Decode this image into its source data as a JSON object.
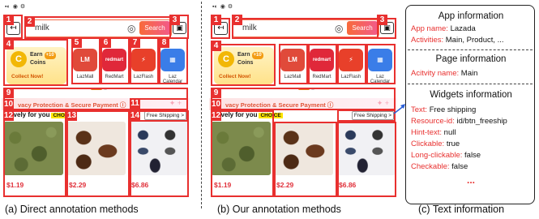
{
  "screen": {
    "search_text": "milk",
    "search_button": "Search",
    "coins_title": "Earn",
    "coins_badge": "+10",
    "coins_label": "Coins",
    "collect_now": "Collect Now!",
    "apps": [
      {
        "icon_text": "LM",
        "label": "LazMall",
        "color": "#e04a3a"
      },
      {
        "icon_text": "redmart",
        "label": "RedMart",
        "color": "#e0283a"
      },
      {
        "icon_text": "⚡",
        "label": "LazFlash",
        "color": "#e8402a"
      },
      {
        "icon_text": "▦",
        "label": "Laz Calendar",
        "color": "#3a7de8"
      }
    ],
    "privacy_text": "vacy Protection & Secure Payment ⓘ",
    "exclusive_text": "usively for you",
    "choice_badge": "CHOICE",
    "free_shipping": "Free Shipping >",
    "prices": [
      "$1.19",
      "$2.29",
      "$6.86"
    ]
  },
  "box_numbers": [
    "1",
    "2",
    "3",
    "4",
    "5",
    "6",
    "7",
    "8",
    "9",
    "10",
    "11",
    "12",
    "13",
    "14"
  ],
  "info": {
    "app_heading": "App information",
    "app_name_key": "App name:",
    "app_name_val": "Lazada",
    "activities_key": "Activities:",
    "activities_val": "Main, Product, ...",
    "page_heading": "Page information",
    "activity_name_key": "Acitvity name:",
    "activity_name_val": "Main",
    "widgets_heading": "Widgets information",
    "text_key": "Text:",
    "text_val": "Free shipping",
    "resource_key": "Resource-id:",
    "resource_val": "id/btn_freeship",
    "hint_key": "Hint-text:",
    "hint_val": "null",
    "clickable_key": "Clickable:",
    "clickable_val": "true",
    "long_clickable_key": "Long-clickable:",
    "long_clickable_val": "false",
    "checkable_key": "Checkable:",
    "checkable_val": "false",
    "ellipsis": "..."
  },
  "captions": {
    "a": "(a) Direct annotation methods",
    "b": "(b) Our annotation methods",
    "c": "(c) Text information"
  },
  "colors": {
    "annotation_red": "#e8302f",
    "search_orange": "#f36f4e"
  }
}
